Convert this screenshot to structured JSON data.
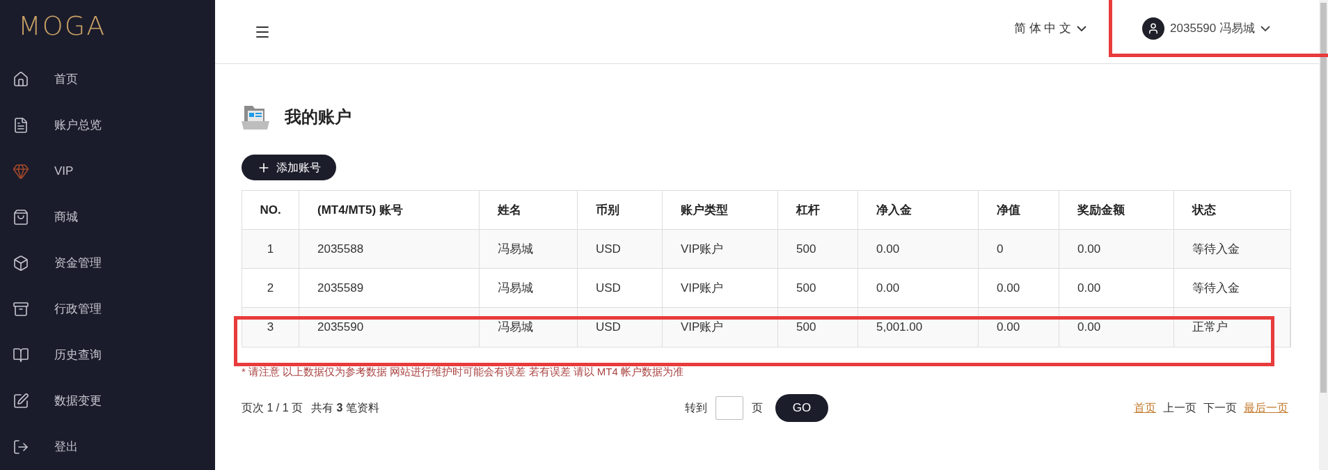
{
  "logo": "MOGA",
  "sidebar": {
    "items": [
      {
        "label": "首页",
        "selected": false
      },
      {
        "label": "账户总览",
        "selected": false
      },
      {
        "label": "VIP",
        "selected": false
      },
      {
        "label": "商城",
        "selected": false
      },
      {
        "label": "资金管理",
        "selected": false
      },
      {
        "label": "行政管理",
        "selected": false
      },
      {
        "label": "历史查询",
        "selected": false
      },
      {
        "label": "数据变更",
        "selected": false
      },
      {
        "label": "登出",
        "selected": false
      }
    ]
  },
  "header": {
    "language": "简 体 中 文",
    "user": {
      "label": "2035590 冯易城",
      "highlighted": true
    }
  },
  "page_title": "我的账户",
  "add_button": "添加账号",
  "table": {
    "columns": [
      "NO.",
      "(MT4/MT5) 账号",
      "姓名",
      "币别",
      "账户类型",
      "杠杆",
      "净入金",
      "净值",
      "奖励金额",
      "状态"
    ],
    "rows": [
      {
        "cells": [
          "1",
          "2035588",
          "冯易城",
          "USD",
          "VIP账户",
          "500",
          "0.00",
          "0",
          "0.00",
          "等待入金"
        ],
        "highlighted": false
      },
      {
        "cells": [
          "2",
          "2035589",
          "冯易城",
          "USD",
          "VIP账户",
          "500",
          "0.00",
          "0.00",
          "0.00",
          "等待入金"
        ],
        "highlighted": false
      },
      {
        "cells": [
          "3",
          "2035590",
          "冯易城",
          "USD",
          "VIP账户",
          "500",
          "5,001.00",
          "0.00",
          "0.00",
          "正常户"
        ],
        "highlighted": true
      }
    ]
  },
  "note": "* 请注意 以上数据仅为参考数据 网站进行维护时可能会有误差 若有误差 请以 MT4 帐户数据为准",
  "pagination": {
    "page_info": "页次 1 / 1 页",
    "total": "共有 **3** 笔资料",
    "goto_label": "转到",
    "page_unit": "页",
    "go_button": "GO",
    "links": [
      {
        "label": "首页",
        "disabled": false
      },
      {
        "label": "上一页",
        "disabled": true
      },
      {
        "label": "下一页",
        "disabled": true
      },
      {
        "label": "最后一页",
        "disabled": false
      }
    ]
  }
}
